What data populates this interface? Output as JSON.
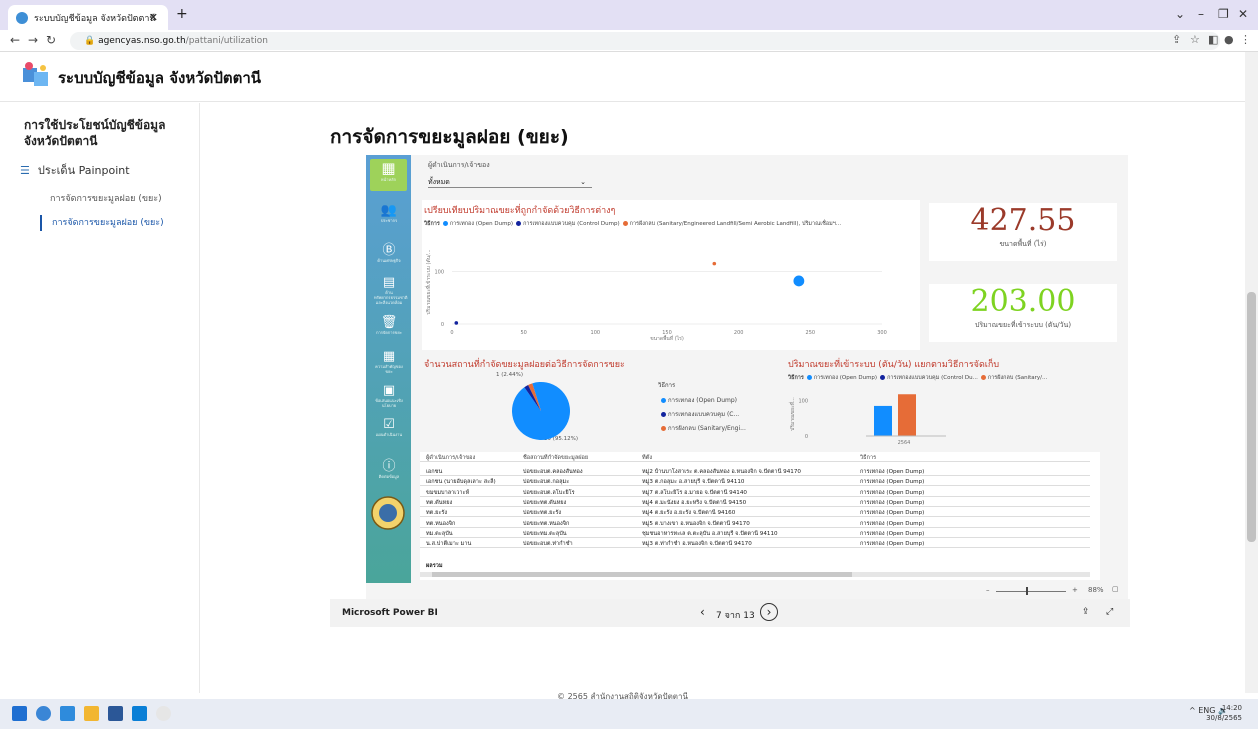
{
  "browser": {
    "tab_title": "ระบบบัญชีข้อมูล จังหวัดปัตตานี",
    "url_host": "agencyas.nso.go.th",
    "url_path": "/pattani/utilization"
  },
  "site": {
    "title": "ระบบบัญชีข้อมูล จังหวัดปัตตานี"
  },
  "sidebar": {
    "heading": "การใช้ประโยชน์บัญชีข้อมูล จังหวัดปัตตานี",
    "section": "ประเด็น Painpoint",
    "items": [
      {
        "label": "การจัดการขยะมูลฝอย (ขยะ)"
      },
      {
        "label": "การจัดการขยะมูลฝอย (ขยะ)"
      }
    ]
  },
  "page": {
    "title": "การจัดการขยะมูลฝอย (ขยะ)"
  },
  "report": {
    "filter_label": "ผู้ดำเนินการ/เจ้าของ",
    "filter_value": "ทั้งหมด",
    "kpi_area_value": "427.55",
    "kpi_area_label": "ขนาดพื้นที่ (ไร่)",
    "kpi_area_color": "#9b3a2a",
    "kpi_volume_value": "203.00",
    "kpi_volume_label": "ปริมาณขยะที่เข้าระบบ (ตัน/วัน)",
    "kpi_volume_color": "#7ed321",
    "scatter_title": "เปรียบเทียบปริมาณขยะที่ถูกกำจัดด้วยวิธีการต่างๆ",
    "scatter_legend_prefix": "วิธีการ",
    "scatter_legend": [
      "การเทกอง (Open Dump)",
      "การเทกองแบบควบคุม (Control Dump)",
      "การฝังกลบ (Sanitary/Engineered Landfill/Semi Aerobic Landfill), ปริมาณเชื่อมฯ..."
    ],
    "scatter_xlabel": "ขนาดพื้นที่ (ไร่)",
    "scatter_ylabel": "ปริมาณขยะที่เข้าระบบ (ตัน/...",
    "pie_title": "จำนวนสถานที่กำจัดขยะมูลฝอยต่อวิธีการจัดการขยะ",
    "pie_label_small": "1 (2.44%)",
    "pie_label_big": "39 (95.12%)",
    "pie_legend_title": "วิธีการ",
    "pie_legend": [
      "การเทกอง (Open Dump)",
      "การเทกองแบบควบคุม (C...",
      "การฝังกลบ (Sanitary/Engi..."
    ],
    "bar_title": "ปริมาณขยะที่เข้าระบบ (ตัน/วัน) แยกตามวิธีการจัดเก็บ",
    "bar_legend_prefix": "วิธีการ",
    "bar_legend": [
      "การเทกอง (Open Dump)",
      "การเทกองแบบควบคุม (Control Du...",
      "การฝังกลบ (Sanitary/..."
    ],
    "bar_ylabel": "ปริมาณขยะที่...",
    "bar_xlabel": "2564",
    "colors": {
      "open_dump": "#118dff",
      "control_dump": "#12239e",
      "landfill": "#e66c37"
    },
    "rail": [
      {
        "icon": "logo",
        "label": "หน้าหลัก"
      },
      {
        "icon": "people-icon",
        "label": "ประชากร"
      },
      {
        "icon": "money-icon",
        "label": "ด้านเศรษฐกิจ"
      },
      {
        "icon": "building-icon",
        "label": "ด้านทรัพยากรธรรมชาติและสิ่งแวดล้อม"
      },
      {
        "icon": "trash-icon",
        "label": "การจัดการขยะ"
      },
      {
        "icon": "calendar-icon",
        "label": "ความสำคัญของขยะ"
      },
      {
        "icon": "person-board-icon",
        "label": "ข้อเสนอแนะเชิงนโยบาย"
      },
      {
        "icon": "checklist-icon",
        "label": "แผนดำเนินงาน"
      },
      {
        "icon": "info-icon",
        "label": "ติดต่อข้อมูล"
      }
    ]
  },
  "chart_data": [
    {
      "type": "scatter",
      "title": "เปรียบเทียบปริมาณขยะที่ถูกกำจัดด้วยวิธีการต่างๆ",
      "xlabel": "ขนาดพื้นที่ (ไร่)",
      "ylabel": "ปริมาณขยะที่เข้าระบบ (ตัน/...",
      "xlim": [
        0,
        300
      ],
      "ylim": [
        0,
        160
      ],
      "xticks": [
        0,
        50,
        100,
        150,
        200,
        250,
        300
      ],
      "yticks": [
        0,
        100
      ],
      "series": [
        {
          "name": "การเทกอง (Open Dump)",
          "color": "#118dff",
          "points": [
            {
              "x": 242,
              "y": 82,
              "size": 3
            }
          ]
        },
        {
          "name": "การเทกองแบบควบคุม (Control Dump)",
          "color": "#12239e",
          "points": [
            {
              "x": 3,
              "y": 2,
              "size": 1
            }
          ]
        },
        {
          "name": "การฝังกลบ (Sanitary/Engineered Landfill/Semi Aerobic Landfill)",
          "color": "#e66c37",
          "points": [
            {
              "x": 183,
              "y": 115,
              "size": 1
            }
          ]
        }
      ]
    },
    {
      "type": "pie",
      "title": "จำนวนสถานที่กำจัดขยะมูลฝอยต่อวิธีการจัดการขยะ",
      "slices": [
        {
          "label": "การเทกอง (Open Dump)",
          "value": 39,
          "percent": 95.12,
          "color": "#118dff"
        },
        {
          "label": "การเทกองแบบควบคุม (C...",
          "value": 1,
          "percent": 2.44,
          "color": "#12239e"
        },
        {
          "label": "การฝังกลบ (Sanitary/Engi...",
          "value": 1,
          "percent": 2.44,
          "color": "#e66c37"
        }
      ]
    },
    {
      "type": "bar",
      "title": "ปริมาณขยะที่เข้าระบบ (ตัน/วัน) แยกตามวิธีการจัดเก็บ",
      "categories": [
        "2564"
      ],
      "ylim": [
        0,
        130
      ],
      "yticks": [
        0,
        100
      ],
      "series": [
        {
          "name": "การเทกอง (Open Dump)",
          "color": "#118dff",
          "values": [
            85
          ]
        },
        {
          "name": "การเทกองแบบควบคุม (Control Du...",
          "color": "#12239e",
          "values": [
            0
          ]
        },
        {
          "name": "การฝังกลบ (Sanitary/...",
          "color": "#e66c37",
          "values": [
            118
          ]
        }
      ]
    }
  ],
  "table": {
    "headers": [
      "ผู้ดำเนินการ/เจ้าของ",
      "ชื่อสถานที่กำจัดขยะมูลฝอย",
      "ที่ตั้ง",
      "วิธีการ"
    ],
    "rows": [
      [
        "เอกชน",
        "บ่อขยะอบต.คลองสันทอง",
        "หมู่2 บ้านบาโงสาเระ ต.คลองสันทอง อ.หนองจิก จ.ปัตตานี 94170",
        "การเทกอง (Open Dump)"
      ],
      [
        "เอกชน (นายอับดุลเลาะ สะลี)",
        "บ่อขยะอบต.กอลุมะ",
        "หมู่3 ต.กอลุมะ อ.สายบุรี จ.ปัตตานี 94110",
        "การเทกอง (Open Dump)"
      ],
      [
        "ขมขมบาลาเวาะห์",
        "บ่อขยะอบต.ลโบะยิโร",
        "หมู่7 ต.ลโบะยิโร อ.มายอ จ.ปัตตานี 94140",
        "การเทกอง (Open Dump)"
      ],
      [
        "ทต.ตันหยง",
        "บ่อขยะทต.ตันหยง",
        "หมู่4 ต.มะนังยง อ.ยะหริ่ง จ.ปัตตานี 94150",
        "การเทกอง (Open Dump)"
      ],
      [
        "ทต.ยะรัง",
        "บ่อขยะทต.ยะรัง",
        "หมู่4 ต.ยะรัง อ.ยะรัง จ.ปัตตานี 94160",
        "การเทกอง (Open Dump)"
      ],
      [
        "ทต.หนองจิก",
        "บ่อขยะทต.หนองจิก",
        "หมู่5 ต.บางเขา อ.หนองจิก จ.ปัตตานี 94170",
        "การเทกอง (Open Dump)"
      ],
      [
        "ทม.ตะลุบัน",
        "บ่อขยะทม.ตะลุบัน",
        "ชุมชนอาหารทะเล ต.ตะลุบัน อ.สายบุรี จ.ปัตตานี 94110",
        "การเทกอง (Open Dump)"
      ],
      [
        "น.ส.ปาตีเมาะ มาน",
        "บ่อขยะอบต.ท่ากำชำ",
        "หมู่3 ต.ท่ากำชำ อ.หนองจิก จ.ปัตตานี 94170",
        "การเทกอง (Open Dump)"
      ]
    ],
    "total_label": "ผลรวม"
  },
  "powerbi": {
    "brand": "Microsoft Power BI",
    "page_indicator": "7 จาก 13",
    "zoom": "88%"
  },
  "footer": {
    "copyright": "© 2565 สำนักงานสถิติจังหวัดปัตตานี"
  },
  "taskbar": {
    "lang": "ENG",
    "time": "14:20",
    "date": "30/8/2565"
  }
}
